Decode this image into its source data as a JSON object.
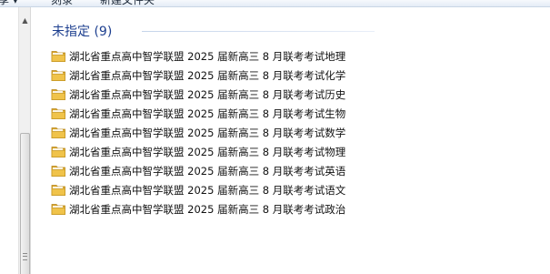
{
  "toolbar": {
    "items": [
      {
        "label": "享 ▾"
      },
      {
        "label": "刻录"
      },
      {
        "label": "新建文件夹"
      }
    ]
  },
  "colors": {
    "group_title": "#1d3f8f",
    "folder": "#e8b93a"
  },
  "group": {
    "title": "未指定 (9)"
  },
  "files": [
    {
      "name": "湖北省重点高中智学联盟 2025 届新高三 8 月联考考试地理",
      "icon": "folder-icon"
    },
    {
      "name": "湖北省重点高中智学联盟 2025 届新高三 8 月联考考试化学",
      "icon": "folder-icon"
    },
    {
      "name": "湖北省重点高中智学联盟 2025 届新高三 8 月联考考试历史",
      "icon": "folder-icon"
    },
    {
      "name": "湖北省重点高中智学联盟 2025 届新高三 8 月联考考试生物",
      "icon": "folder-icon"
    },
    {
      "name": "湖北省重点高中智学联盟 2025 届新高三 8 月联考考试数学",
      "icon": "folder-icon"
    },
    {
      "name": "湖北省重点高中智学联盟 2025 届新高三 8 月联考考试物理",
      "icon": "folder-icon"
    },
    {
      "name": "湖北省重点高中智学联盟 2025 届新高三 8 月联考考试英语",
      "icon": "folder-icon"
    },
    {
      "name": "湖北省重点高中智学联盟 2025 届新高三 8 月联考考试语文",
      "icon": "folder-icon"
    },
    {
      "name": "湖北省重点高中智学联盟 2025 届新高三 8 月联考考试政治",
      "icon": "folder-icon"
    }
  ]
}
